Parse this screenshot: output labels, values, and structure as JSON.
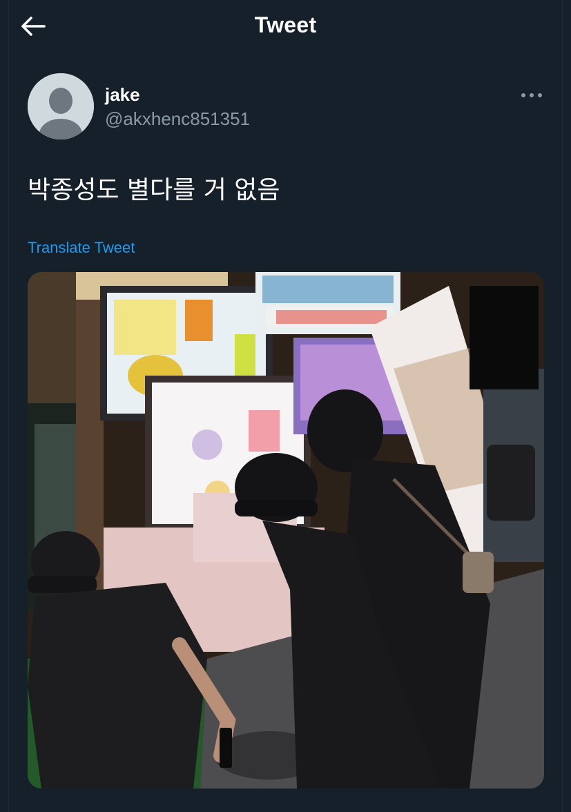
{
  "header": {
    "back_icon": "arrow-left-icon",
    "title": "Tweet"
  },
  "author": {
    "avatar_icon": "default-avatar-icon",
    "display_name": "jake",
    "handle": "@akxhenc851351"
  },
  "more_icon": "more-horizontal-icon",
  "tweet": {
    "text": "박종성도 별다를 거 없음",
    "translate_label": "Translate Tweet"
  },
  "colors": {
    "background": "#15202b",
    "primary_text": "#ffffff",
    "secondary_text": "#8b98a5",
    "accent": "#1d9bf0"
  }
}
